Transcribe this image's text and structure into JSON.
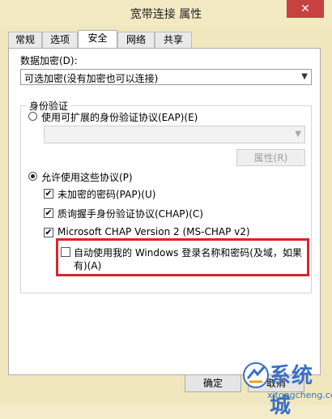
{
  "window": {
    "title": "宽带连接 属性",
    "close_glyph": "✕"
  },
  "tabs": [
    "常规",
    "选项",
    "安全",
    "网络",
    "共享"
  ],
  "active_tab": "安全",
  "encryption": {
    "label": "数据加密(D):",
    "value": "可选加密(没有加密也可以连接)"
  },
  "auth": {
    "group_label": "身份验证",
    "eap_radio_label": "使用可扩展的身份验证协议(EAP)(E)",
    "properties_button": "属性(R)",
    "allow_radio_label": "允许使用这些协议(P)",
    "protocols": [
      {
        "label": "未加密的密码(PAP)(U)",
        "checked": true
      },
      {
        "label": "质询握手身份验证协议(CHAP)(C)",
        "checked": true
      },
      {
        "label": "Microsoft CHAP Version 2 (MS-CHAP v2)",
        "checked": true
      }
    ],
    "auto_login_line1": "自动使用我的 Windows 登录名称和密码(及域，如果",
    "auto_login_line2": "有)(A)",
    "auto_login_checked": false
  },
  "footer": {
    "ok": "确定",
    "cancel": "取消"
  },
  "watermark": {
    "text": "系统城",
    "sub": "xitongcheng.com"
  },
  "colors": {
    "highlight": "#d6262a",
    "close": "#c74141",
    "watermark": "#3a6fc4"
  }
}
